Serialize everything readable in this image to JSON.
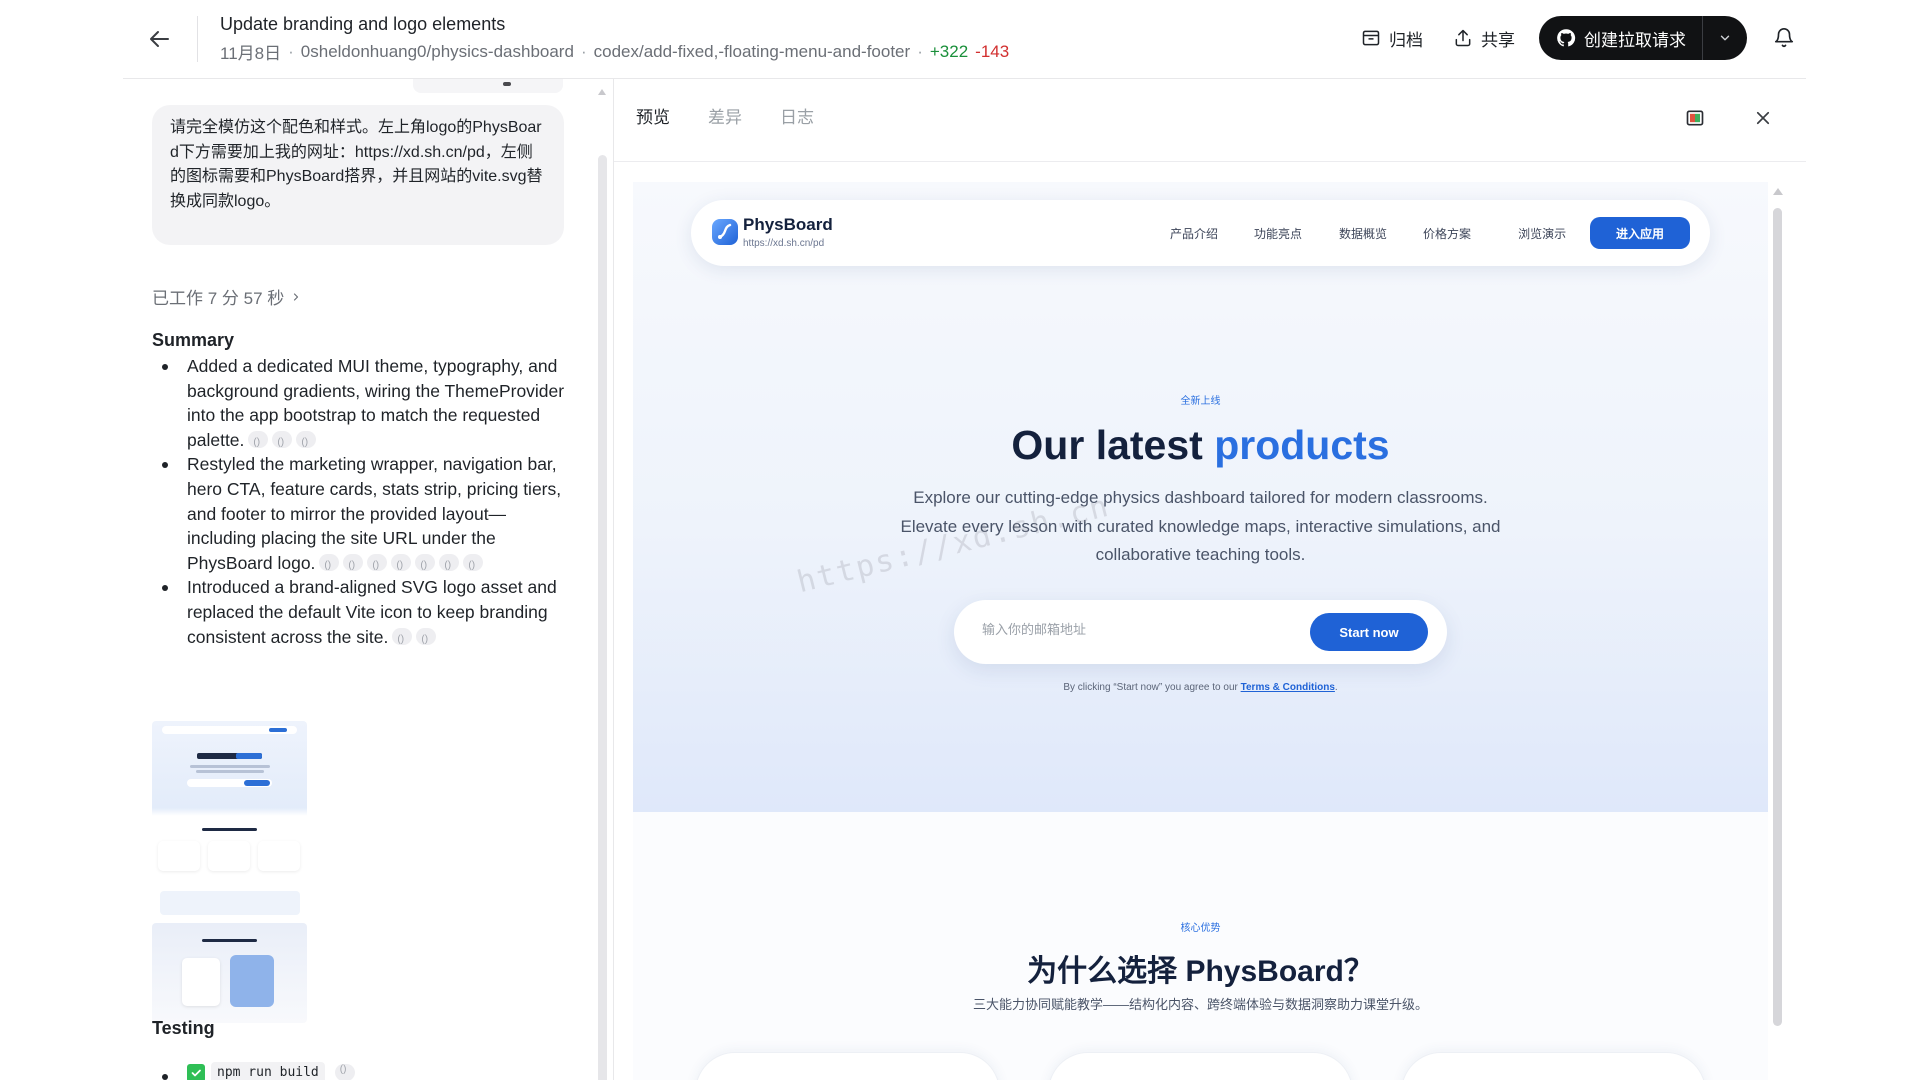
{
  "header": {
    "title": "Update branding and logo elements",
    "date": "11月8日",
    "repo": "0sheldonhuang0/physics-dashboard",
    "branch": "codex/add-fixed,-floating-menu-and-footer",
    "additions": "+322",
    "deletions": "-143",
    "archive_label": "归档",
    "share_label": "共享",
    "pr_label": "创建拉取请求"
  },
  "chat": {
    "user_message": "请完全模仿这个配色和样式。左上角logo的PhysBoard下方需要加上我的网址：https://xd.sh.cn/pd，左侧的图标需要和PhysBoard搭界，并且网站的vite.svg替换成同款logo。",
    "worked_label": "已工作 7 分 57 秒",
    "summary_heading": "Summary",
    "summary_items": [
      "Added a dedicated MUI theme, typography, and background gradients, wiring the ThemeProvider into the app bootstrap to match the requested palette.",
      "Restyled the marketing wrapper, navigation bar, hero CTA, feature cards, stats strip, pricing tiers, and footer to mirror the provided layout—including placing the site URL under the PhysBoard logo.",
      "Introduced a brand-aligned SVG logo asset and replaced the default Vite icon to keep branding consistent across the site."
    ],
    "testing_heading": "Testing",
    "test_command": "npm run build"
  },
  "preview": {
    "tabs": [
      "预览",
      "差异",
      "日志"
    ],
    "active_tab": "预览",
    "site": {
      "brand": "PhysBoard",
      "url": "https://xd.sh.cn/pd",
      "nav_links": [
        "产品介绍",
        "功能亮点",
        "数据概览",
        "价格方案",
        "浏览演示"
      ],
      "enter_label": "进入应用",
      "badge": "全新上线",
      "title_main": "Our latest ",
      "title_accent": "products",
      "subtitle": "Explore our cutting-edge physics dashboard tailored for modern classrooms. Elevate every lesson with curated knowledge maps, interactive simulations, and collaborative teaching tools.",
      "email_placeholder": "输入你的邮箱地址",
      "start_label": "Start now",
      "terms_prefix": "By clicking “Start now” you agree to our ",
      "terms_link": "Terms & Conditions",
      "terms_suffix": ".",
      "watermark": "https://xd.sh.cn",
      "sec2_badge": "核心优势",
      "sec2_title": "为什么选择 PhysBoard？",
      "sec2_sub": "三大能力协同赋能教学——结构化内容、跨终端体验与数据洞察助力课堂升级。"
    }
  },
  "colors": {
    "accent": "#1f62d6",
    "accent_text": "#2a6fe0",
    "additions": "#1a8f3a",
    "deletions": "#d22f2f",
    "check": "#2fbf56"
  }
}
